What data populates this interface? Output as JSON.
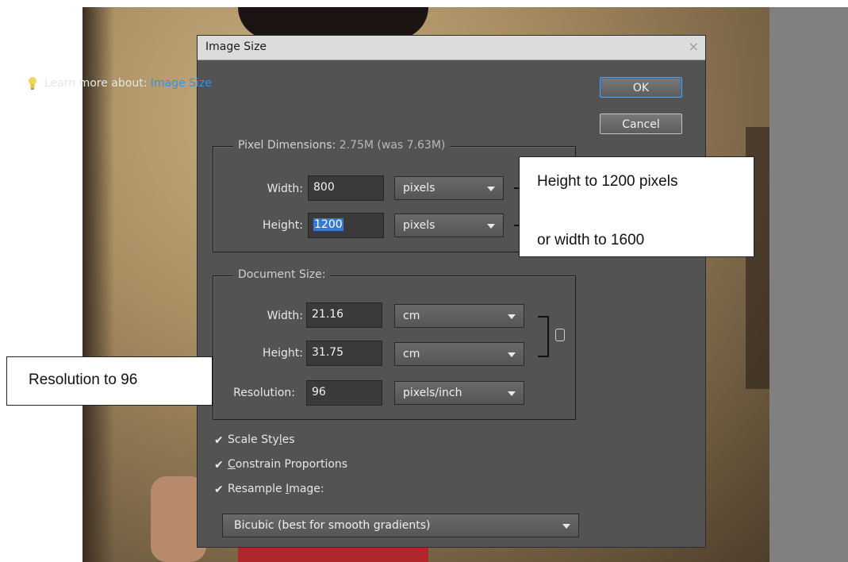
{
  "dialog": {
    "title": "Image Size",
    "close_glyph": "×",
    "learn_prefix": "Learn more about: ",
    "learn_link": "Image Size",
    "ok_label": "OK",
    "cancel_label": "Cancel",
    "pixel_dimensions": {
      "legend_prefix": "Pixel Dimensions:  ",
      "legend_value": "2.75M (was 7.63M)",
      "width_label": "Width:",
      "width_value": "800",
      "width_unit": "pixels",
      "height_label": "Height:",
      "height_value": "1200",
      "height_unit": "pixels"
    },
    "document_size": {
      "legend": "Document Size:",
      "width_label": "Width:",
      "width_value": "21.16",
      "width_unit": "cm",
      "height_label": "Height:",
      "height_value": "31.75",
      "height_unit": "cm",
      "resolution_label": "Resolution:",
      "resolution_value": "96",
      "resolution_unit": "pixels/inch"
    },
    "checkboxes": {
      "scale_styles_a": "Scale Sty",
      "scale_styles_u": "l",
      "scale_styles_b": "es",
      "constrain_u": "C",
      "constrain_b": "onstrain Proportions",
      "resample_a": "Resample ",
      "resample_u": "I",
      "resample_b": "mage:"
    },
    "resample_method": "Bicubic (best for smooth gradients)"
  },
  "annotations": {
    "top_line1": "Height to 1200 pixels",
    "top_line2": "or width to 1600",
    "left_line1": "Resolution to 96"
  },
  "icons": [
    "lightbulb-icon",
    "close-icon",
    "chain-link-icon",
    "checkmark-icon",
    "dropdown-arrow-icon"
  ]
}
